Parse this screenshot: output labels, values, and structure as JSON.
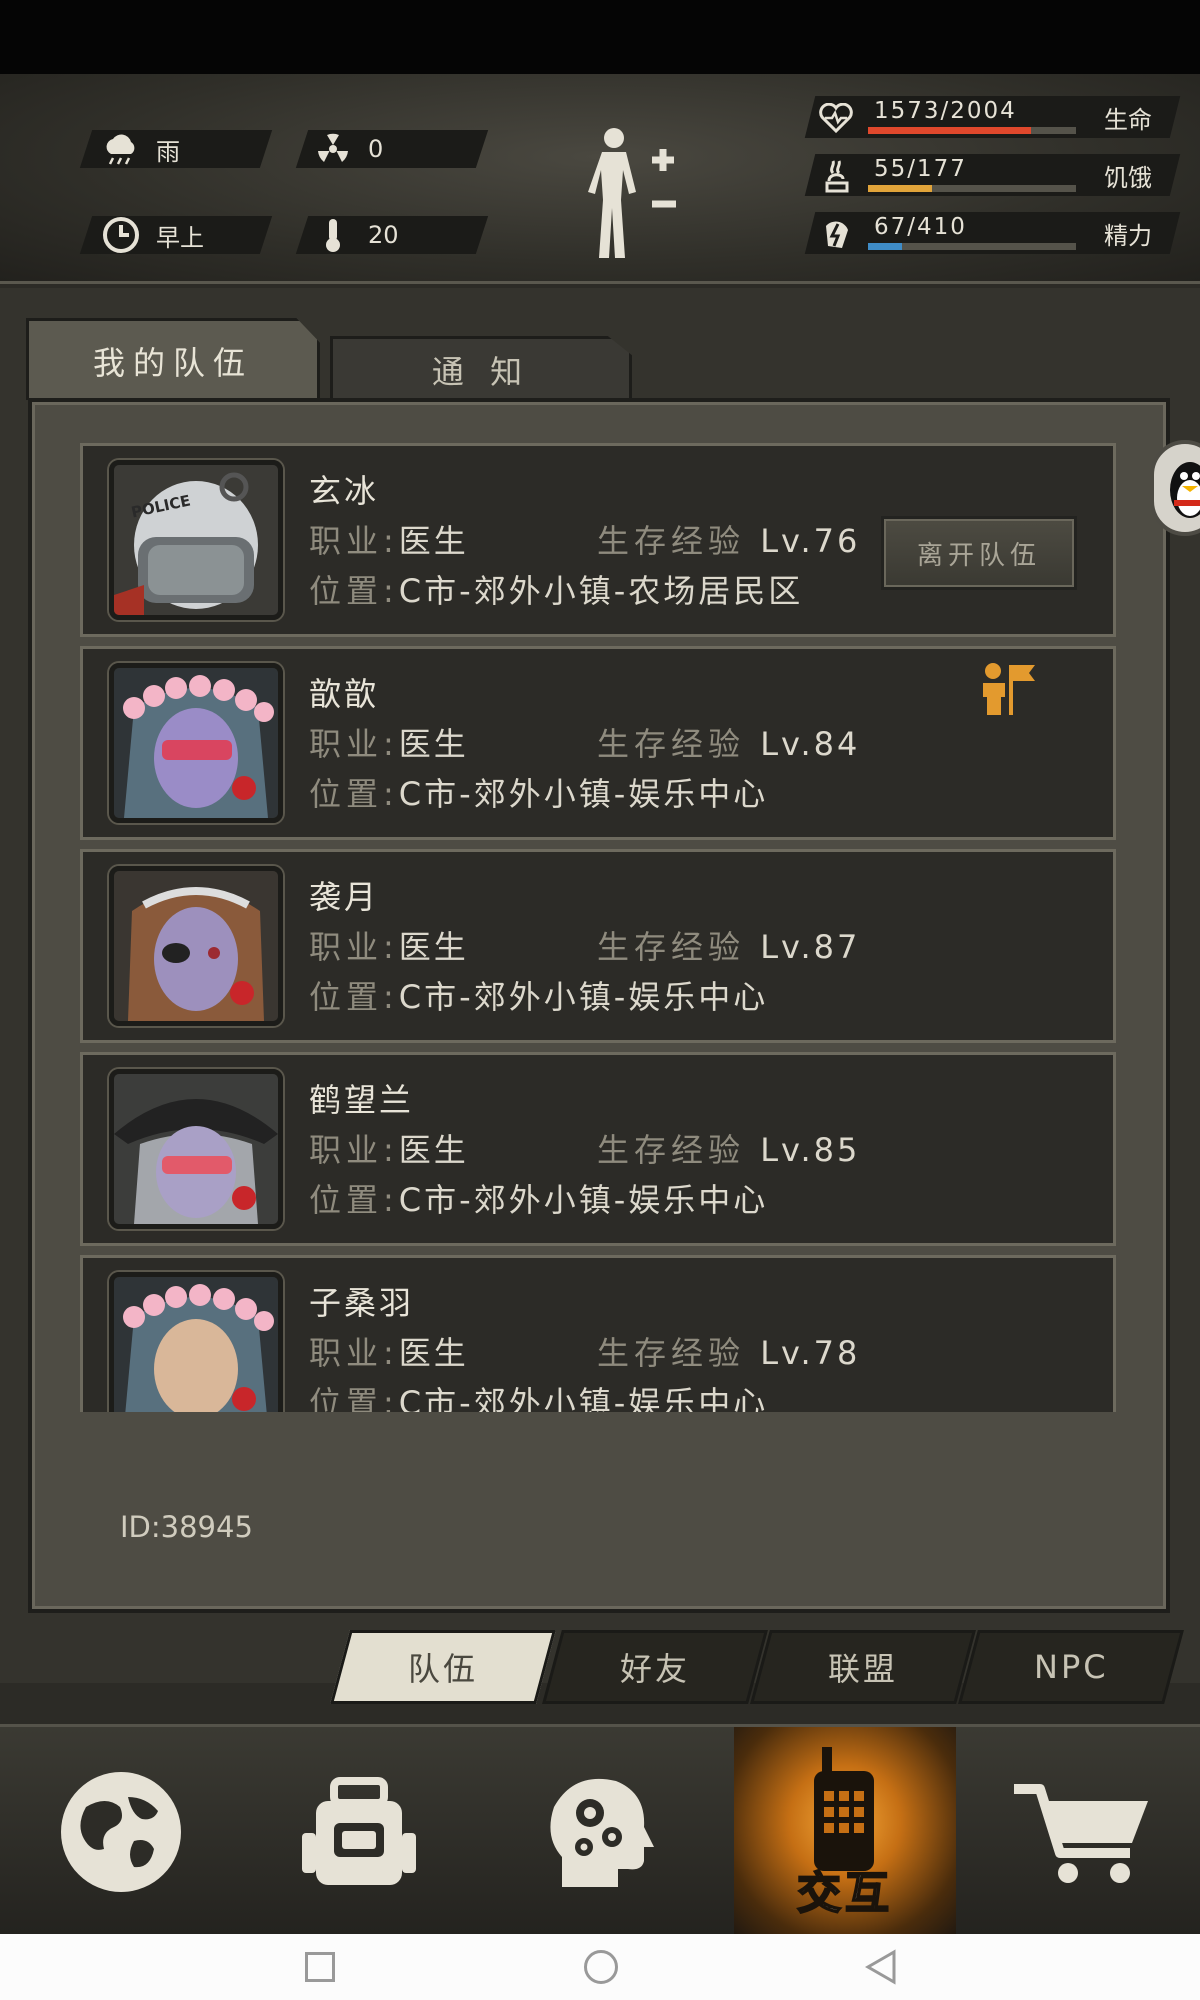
{
  "hud": {
    "weather": "雨",
    "radiation": "0",
    "time_of_day": "早上",
    "temperature": "20",
    "stats": [
      {
        "icon": "heart-icon",
        "value": "1573/2004",
        "label": "生命",
        "fill": 0.785,
        "color": "#e0482c"
      },
      {
        "icon": "hunger-icon",
        "value": "55/177",
        "label": "饥饿",
        "fill": 0.31,
        "color": "#e1a43a"
      },
      {
        "icon": "energy-icon",
        "value": "67/410",
        "label": "精力",
        "fill": 0.163,
        "color": "#3f8cc7"
      }
    ]
  },
  "tabs": {
    "team": "我的队伍",
    "notice": "通 知"
  },
  "members": [
    {
      "name": "玄冰",
      "job_label": "职业:",
      "job": "医生",
      "exp_label": "生存经验",
      "level": "Lv.76",
      "loc_label": "位置:",
      "location": "C市-郊外小镇-农场居民区",
      "leave_button": "离开队伍"
    },
    {
      "name": "歆歆",
      "job_label": "职业:",
      "job": "医生",
      "exp_label": "生存经验",
      "level": "Lv.84",
      "loc_label": "位置:",
      "location": "C市-郊外小镇-娱乐中心"
    },
    {
      "name": "袭月",
      "job_label": "职业:",
      "job": "医生",
      "exp_label": "生存经验",
      "level": "Lv.87",
      "loc_label": "位置:",
      "location": "C市-郊外小镇-娱乐中心"
    },
    {
      "name": "鹤望兰",
      "job_label": "职业:",
      "job": "医生",
      "exp_label": "生存经验",
      "level": "Lv.85",
      "loc_label": "位置:",
      "location": "C市-郊外小镇-娱乐中心"
    },
    {
      "name": "子桑羽",
      "job_label": "职业:",
      "job": "医生",
      "exp_label": "生存经验",
      "level": "Lv.78",
      "loc_label": "位置:",
      "location": "C市-郊外小镇-娱乐中心"
    }
  ],
  "user_id": "ID:38945",
  "subtabs": [
    "队伍",
    "好友",
    "联盟",
    "NPC"
  ],
  "nav": {
    "interact_label": "交互"
  }
}
